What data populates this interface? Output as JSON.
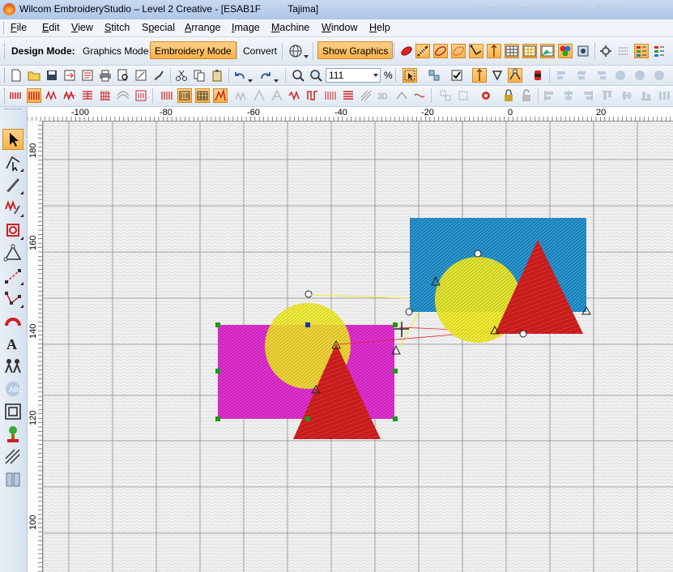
{
  "window": {
    "title": "Wilcom EmbroideryStudio – Level 2 Creative - [ESAB1F          Tajima]",
    "ghost_text": "Level 2 Creative - [ESAB1F    Tajima"
  },
  "menu": [
    "File",
    "Edit",
    "View",
    "Stitch",
    "Special",
    "Arrange",
    "Image",
    "Machine",
    "Window",
    "Help"
  ],
  "menu_mnemonic_index": [
    0,
    0,
    0,
    0,
    1,
    0,
    0,
    0,
    0,
    0
  ],
  "design_mode": {
    "label": "Design Mode:",
    "graphics_mode": "Graphics Mode",
    "embroidery_mode": "Embroidery Mode",
    "convert": "Convert",
    "show_graphics": "Show Graphics",
    "active": "Embroidery Mode"
  },
  "zoom": {
    "value": "111",
    "unit": "%"
  },
  "ruler": {
    "top_labels": [
      "-100",
      "-80",
      "-60",
      "-40",
      "-20",
      "0",
      "20"
    ],
    "left_labels": [
      "180",
      "160",
      "140",
      "120",
      "100"
    ]
  },
  "colors": {
    "accent_active": "#fbb248",
    "grid_line": "#8c8c8c",
    "magenta": "#e633d6",
    "yellow": "#f5ef2a",
    "red": "#e02828",
    "cyan": "#2c9bd4"
  },
  "icons": {
    "toolbar2": [
      "pencil-feather-icon",
      "satin-column-icon",
      "tatami-fill-icon",
      "complex-fill-icon",
      "hatch-fill-icon",
      "globe-icon",
      "color-grid-icon",
      "table-icon",
      "image-icon",
      "palette-icon",
      "sequence-icon",
      "stitch-grid-icon",
      "thread-colors-icon",
      "color-list-icon"
    ],
    "toolbar3": [
      "new-file-icon",
      "open-folder-icon",
      "save-icon",
      "export-icon",
      "print-icon",
      "print-preview-icon",
      "open-design-icon",
      "properties-icon",
      "cut-icon",
      "copy-icon",
      "paste-icon",
      "undo-icon",
      "redo-icon",
      "zoom-box-icon",
      "zoom-icon"
    ],
    "toolbar3_right": [
      "select-icon",
      "lock-icon",
      "checkbox-icon",
      "needle-icon",
      "down-arrow-icon",
      "brush-icon",
      "group-icon",
      "align-icons"
    ],
    "toolbar4": [
      "running-stitch-icon",
      "satin-stitch-icon",
      "tatami-icon",
      "zigzag-icon",
      "fill-stitch-icon",
      "curve-stitch-icon",
      "lettering-stitch-icon",
      "outline-icon",
      "pattern-icon",
      "effect-icon"
    ],
    "toolbox": [
      "select-arrow-icon",
      "reshape-icon",
      "knife-icon",
      "stitch-edit-icon",
      "paste-icon",
      "node-icon",
      "line-icon",
      "polyline-icon",
      "arc-icon",
      "lettering-icon",
      "people-icon",
      "monogram-icon",
      "appliqué-icon",
      "tree-icon",
      "stripes-icon",
      "align-icon"
    ]
  }
}
